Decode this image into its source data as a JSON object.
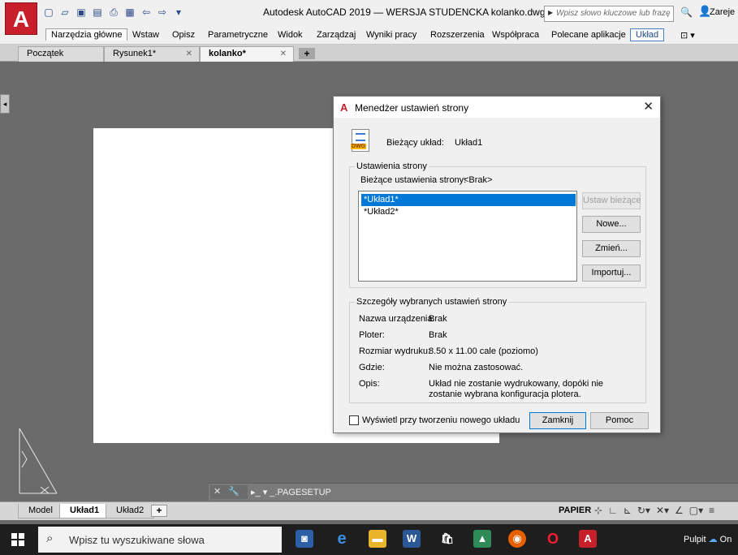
{
  "window": {
    "title": "Autodesk AutoCAD 2019 — WERSJA STUDENCKA    kolanko.dwg",
    "logo_letter": "A",
    "search_placeholder": "Wpisz słowo kluczowe lub frazę",
    "signin": "Zareje"
  },
  "ribbon": {
    "tabs": [
      "Narzędzia główne",
      "Wstaw",
      "Opisz",
      "Parametryczne",
      "Widok",
      "Zarządzaj",
      "Wyniki pracy",
      "Rozszerzenia",
      "Współpraca",
      "Polecane aplikacje",
      "Układ"
    ],
    "active_tab": "Narzędzia główne"
  },
  "document_tabs": {
    "items": [
      "Początek",
      "Rysunek1*",
      "kolanko*"
    ],
    "active": "kolanko*",
    "new_tab_symbol": "+"
  },
  "command_line": {
    "controls": "✕ 🔧",
    "prompt": "▸_ ▾ _.PAGESETUP"
  },
  "layout_tabs": {
    "items": [
      "Model",
      "Układ1",
      "Układ2"
    ],
    "active": "Układ1",
    "add_symbol": "+"
  },
  "status_bar": {
    "space": "PAPIER"
  },
  "taskbar": {
    "search_placeholder": "Wpisz tu wyszukiwane słowa",
    "tray_text": "Pulpit",
    "tray_cloud": "On"
  },
  "dialog": {
    "title": "Menedżer ustawień strony",
    "current_layout_label": "Bieżący układ:",
    "current_layout_value": "Układ1",
    "page_setups_group": "Ustawienia strony",
    "current_page_setup_label": "Bieżące ustawienia strony:",
    "current_page_setup_value": "<Brak>",
    "list_items": [
      "*Układ1*",
      "*Układ2*"
    ],
    "selected_item": "*Układ1*",
    "buttons": {
      "set_current": "Ustaw bieżące",
      "new": "Nowe...",
      "modify": "Zmień...",
      "import": "Importuj..."
    },
    "details_group": "Szczegóły wybranych ustawień strony",
    "details": [
      {
        "label": "Nazwa urządzenia:",
        "value": "Brak"
      },
      {
        "label": "Ploter:",
        "value": "Brak"
      },
      {
        "label": "Rozmiar wydruku:",
        "value": "8.50 x 11.00 cale (poziomo)"
      },
      {
        "label": "Gdzie:",
        "value": "Nie można zastosować."
      },
      {
        "label": "Opis:",
        "value": "Układ nie zostanie wydrukowany, dopóki nie zostanie wybrana konfiguracja plotera."
      }
    ],
    "show_on_new_layout": "Wyświetl przy tworzeniu nowego układu",
    "close_button": "Zamknij",
    "help_button": "Pomoc"
  },
  "colors": {
    "accent_red": "#c8202a",
    "selection_blue": "#0078d7",
    "workspace_gray": "#6b6b6b"
  }
}
